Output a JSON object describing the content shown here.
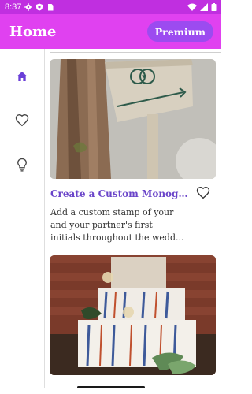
{
  "status_bar": {
    "time": "8:37",
    "icons": [
      "gear-icon",
      "shield-icon",
      "sim-card-icon",
      "wifi-icon",
      "signal-icon",
      "battery-icon"
    ]
  },
  "app_bar": {
    "title": "Home",
    "premium_label": "Premium"
  },
  "side_rail": {
    "items": [
      {
        "name": "home",
        "icon": "home-icon",
        "active": true
      },
      {
        "name": "favorites",
        "icon": "heart-outline-icon",
        "active": false
      },
      {
        "name": "ideas",
        "icon": "lightbulb-icon",
        "active": false
      }
    ]
  },
  "cards": [
    {
      "title": "Create a Custom Monogr...",
      "description_lines": [
        "Add a custom stamp of your",
        "and your partner's first",
        "initials throughout the wedd..."
      ],
      "image": "wooden-monogram-sign-photo"
    },
    {
      "image": "decorated-wedding-cake-photo"
    }
  ],
  "colors": {
    "status_bar": "#c02fe0",
    "app_bar": "#e041f0",
    "premium_button": "#9c4bf0",
    "title_accent": "#6a44c9",
    "rail_active": "#6a3fd8"
  }
}
